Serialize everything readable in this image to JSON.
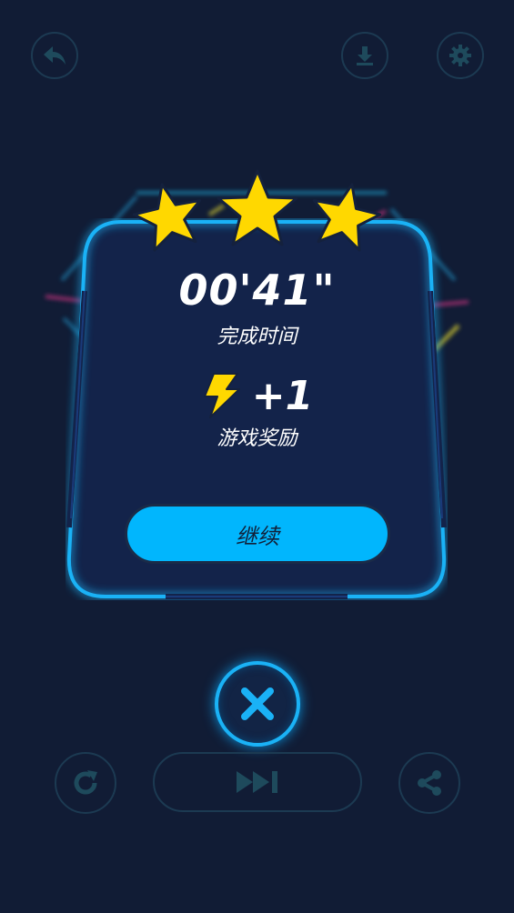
{
  "result": {
    "time": "00'41\"",
    "time_label": "完成时间",
    "reward_amount": "+1",
    "reward_label": "游戏奖励",
    "stars_earned": 3,
    "stars_total": 3
  },
  "buttons": {
    "continue_label": "继续"
  },
  "icons": {
    "back": "back-arrow-icon",
    "download": "download-icon",
    "settings": "gear-icon",
    "energy": "lightning-bolt-icon",
    "close": "close-icon",
    "restart": "restart-icon",
    "skip": "skip-forward-icon",
    "share": "share-icon"
  },
  "colors": {
    "background": "#111c35",
    "accent": "#01b6fd",
    "star": "#ffd800",
    "icon_dim": "#1e4a5c"
  }
}
